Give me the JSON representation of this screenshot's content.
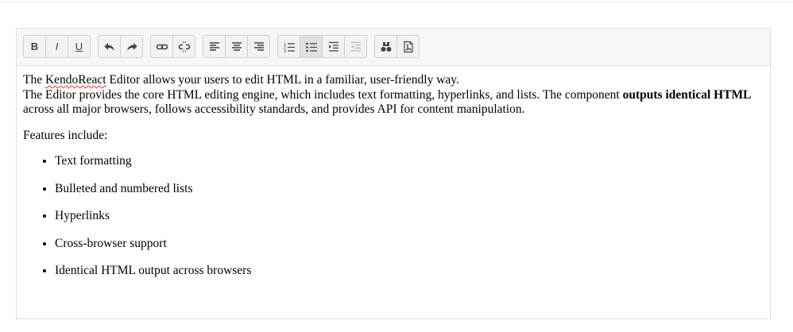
{
  "toolbar": {
    "buttons": [
      {
        "name": "bold-button",
        "label": "B"
      },
      {
        "name": "italic-button",
        "label": "I"
      },
      {
        "name": "underline-button",
        "label": "U"
      }
    ]
  },
  "content": {
    "p1_a": "The ",
    "p1_misspelled": "KendoReact",
    "p1_b": " Editor allows your users to edit HTML in a familiar, user-friendly way.",
    "p1_c": "The Editor provides the core HTML editing engine, which includes text formatting, hyperlinks, and lists. The component ",
    "p1_bold": "outputs identical HTML",
    "p1_d": " across all major browsers, follows accessibility standards, and provides API for content manipulation.",
    "p2": "Features include:",
    "features": [
      "Text formatting",
      "Bulleted and numbered lists",
      "Hyperlinks",
      "Cross-browser support",
      "Identical HTML output across browsers"
    ]
  },
  "icons": [
    "bold-icon",
    "italic-icon",
    "underline-icon",
    "undo-icon",
    "redo-icon",
    "link-icon",
    "unlink-icon",
    "align-left-icon",
    "align-center-icon",
    "align-right-icon",
    "ordered-list-icon",
    "unordered-list-icon",
    "indent-icon",
    "outdent-icon",
    "find-replace-icon",
    "pdf-export-icon"
  ]
}
